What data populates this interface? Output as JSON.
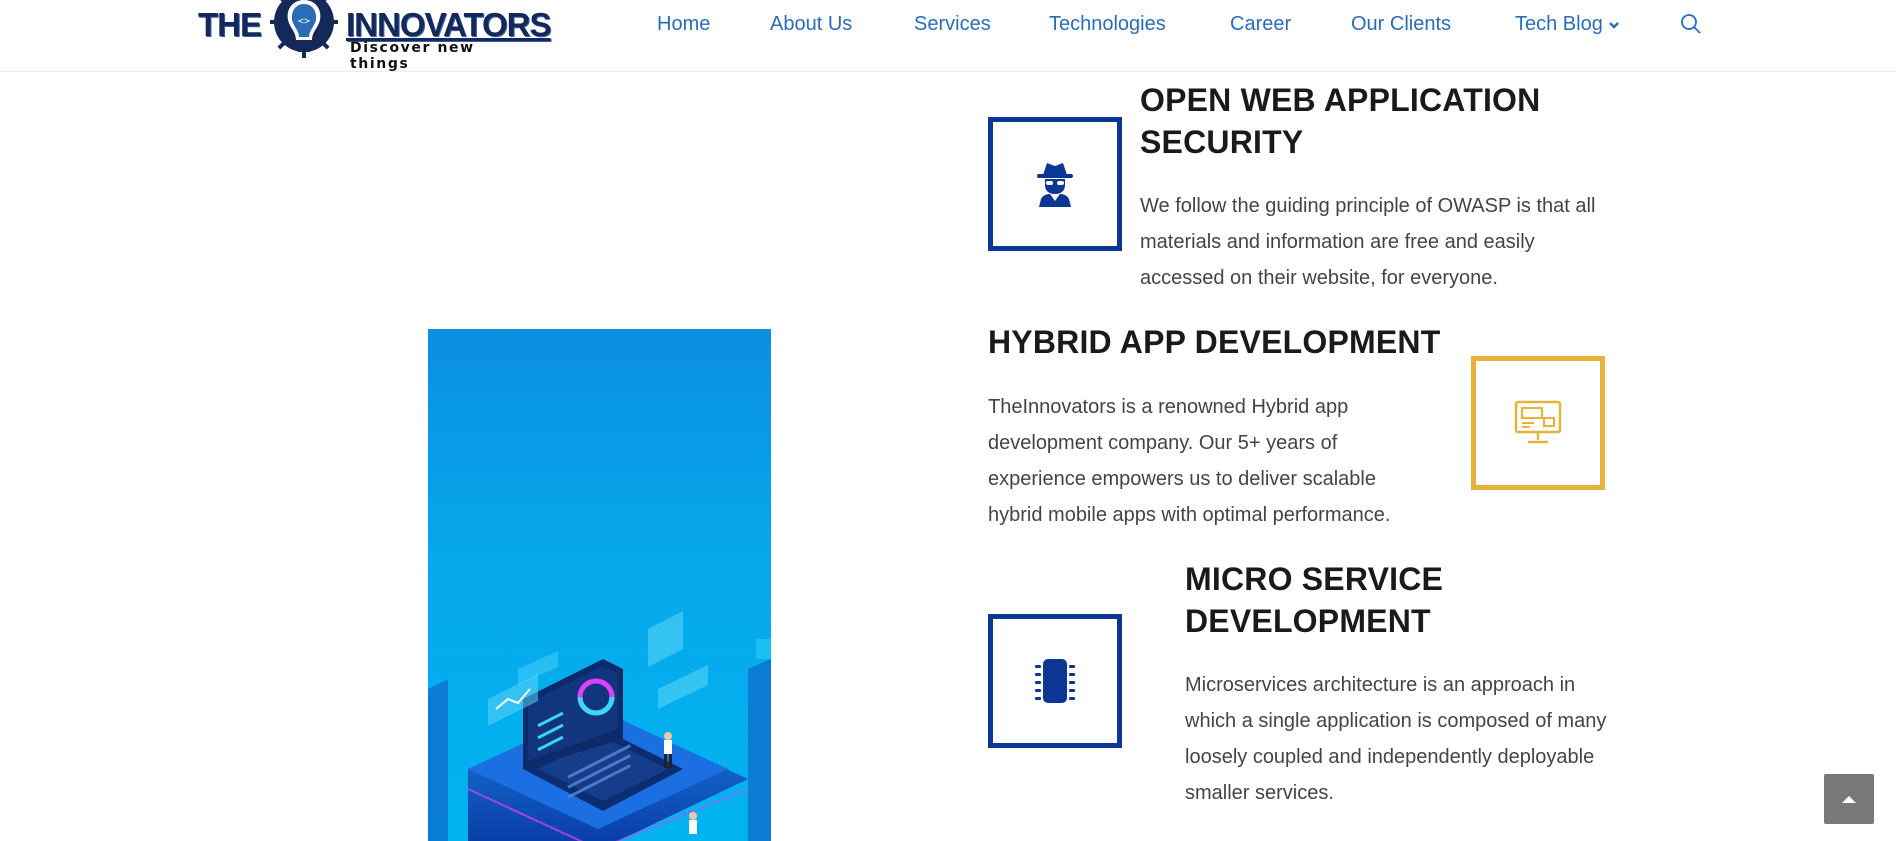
{
  "brand": {
    "logo_main_left": "THE",
    "logo_main_right": "INNOVATORS",
    "logo_tagline": "Discover new things",
    "logo_icon": "lightbulb-gear-icon"
  },
  "nav": {
    "items": [
      {
        "label": "Home"
      },
      {
        "label": "About Us"
      },
      {
        "label": "Services"
      },
      {
        "label": "Technologies"
      },
      {
        "label": "Career"
      },
      {
        "label": "Our Clients"
      },
      {
        "label": "Tech Blog",
        "has_dropdown": true
      }
    ],
    "search_icon": "search-icon",
    "link_color": "#2a6db6"
  },
  "hero_image": {
    "icon": "isometric-laptop-illustration",
    "accent": "#00b3f0"
  },
  "features": [
    {
      "title_line1": "OPEN WEB APPLICATION",
      "title_line2": "SECURITY",
      "desc_line1": "We follow the guiding principle of OWASP is that all",
      "desc_line2": "materials and information are free and easily",
      "desc_line3": "accessed on their website, for everyone.",
      "icon": "spy-icon",
      "border_color": "#0b3693"
    },
    {
      "title_line1": "HYBRID APP DEVELOPMENT",
      "desc_line1": "TheInnovators is a renowned Hybrid app",
      "desc_line2": "development company. Our 5+ years of",
      "desc_line3": "experience empowers us to deliver scalable",
      "desc_line4": "hybrid mobile apps with optimal performance.",
      "icon": "monitor-app-icon",
      "border_color": "#e8b23a"
    },
    {
      "title_line1": "MICRO SERVICE",
      "title_line2": "DEVELOPMENT",
      "desc_line1": "Microservices architecture is an approach in",
      "desc_line2": "which a single application is composed of many",
      "desc_line3": "loosely coupled and independently deployable",
      "desc_line4": "smaller services.",
      "icon": "microchip-icon",
      "border_color": "#0b3693"
    }
  ],
  "back_to_top": {
    "icon": "chevron-up-icon"
  }
}
